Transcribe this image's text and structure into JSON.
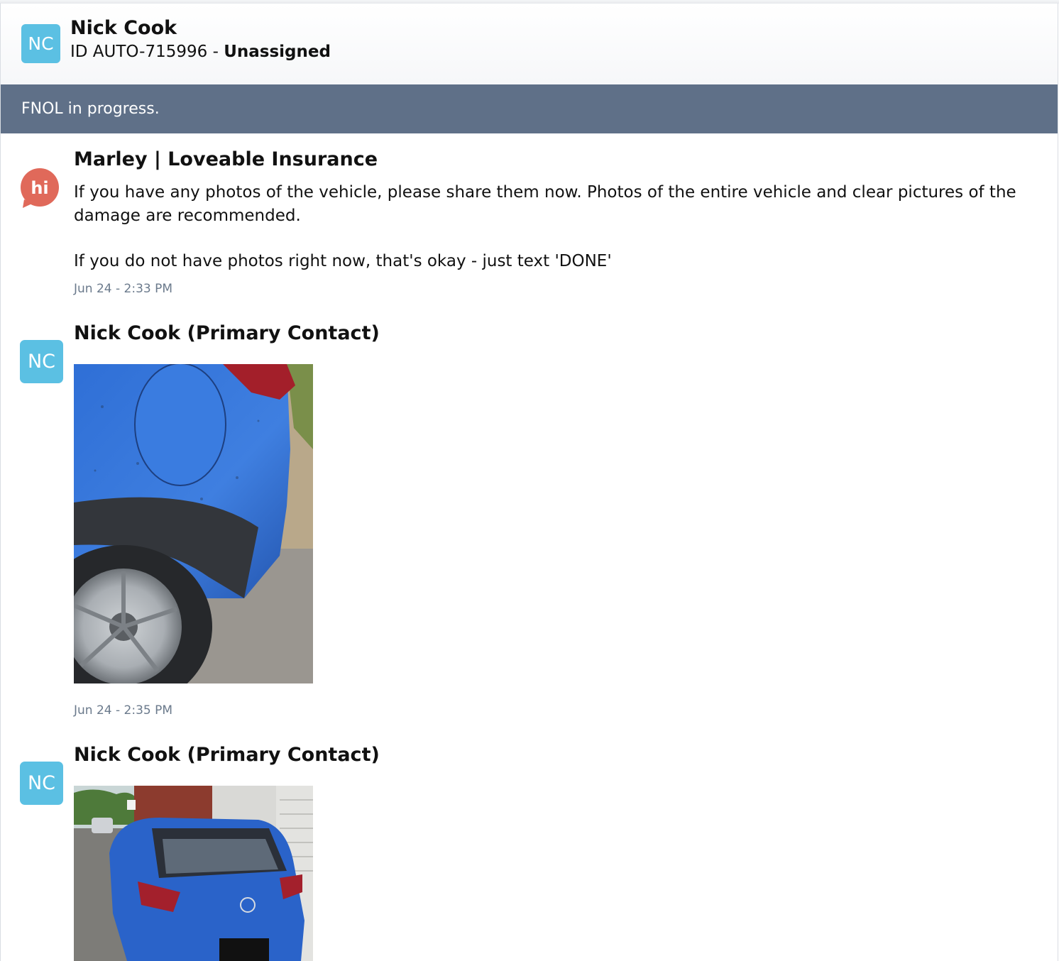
{
  "header": {
    "avatar_initials": "NC",
    "name": "Nick Cook",
    "id_prefix": "ID AUTO-715996 - ",
    "assignment": "Unassigned"
  },
  "banner": {
    "text": "FNOL in progress."
  },
  "messages": [
    {
      "sender": "Marley | Loveable Insurance",
      "avatar_icon": "chat-bubble-hi-icon",
      "avatar_text": "hi",
      "paragraphs": [
        "If you have any photos of the vehicle, please share them now. Photos of the entire vehicle and clear pictures of the damage are recommended.",
        "If you do not have photos right now, that's okay - just text 'DONE'"
      ],
      "time": "Jun 24 - 2:33 PM"
    },
    {
      "sender": "Nick Cook (Primary Contact)",
      "avatar_initials": "NC",
      "attachment": "photo of blue car rear wheel and fuel door",
      "time": "Jun 24 - 2:35 PM"
    },
    {
      "sender": "Nick Cook (Primary Contact)",
      "avatar_initials": "NC",
      "attachment": "photo of blue SUV rear parked on street"
    }
  ],
  "colors": {
    "avatar": "#5bc0e3",
    "bot_avatar": "#e0695a",
    "banner": "#5f7088",
    "timestamp": "#6b7a8c"
  }
}
